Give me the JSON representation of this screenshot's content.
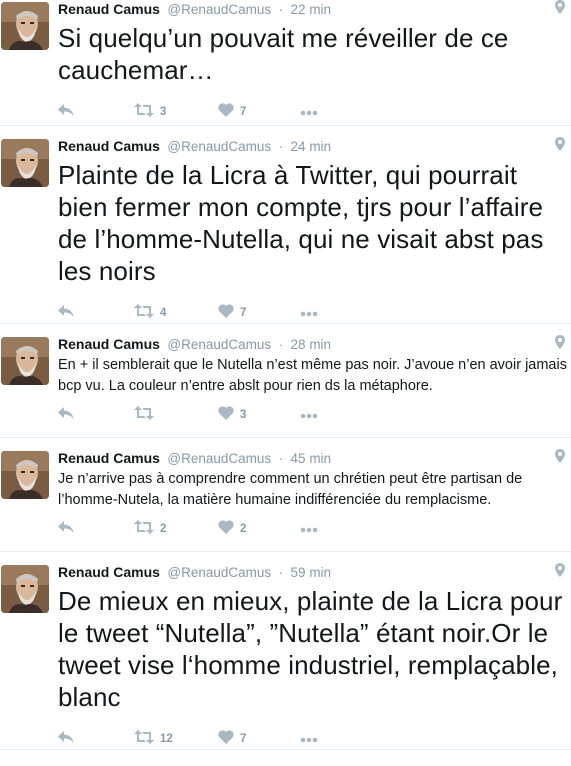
{
  "author": {
    "name": "Renaud Camus",
    "handle": "@RenaudCamus"
  },
  "separator": "·",
  "tweets": [
    {
      "time": "22 min",
      "text": "Si quelqu’un pouvait me réveiller de ce cauchemar…",
      "retweets": "3",
      "likes": "7"
    },
    {
      "time": "24 min",
      "text": "Plainte de la Licra à Twitter, qui pourrait bien fermer mon compte, tjrs pour l’affaire de l’homme-Nutella, qui ne visait abst pas les noirs",
      "retweets": "4",
      "likes": "7"
    },
    {
      "time": "28 min",
      "text": "En + il semblerait que le Nutella n’est même pas noir. J’avoue n’en avoir jamais bcp vu. La couleur n’entre abslt pour rien ds la métaphore.",
      "retweets": "",
      "likes": "3"
    },
    {
      "time": "45 min",
      "text": "Je n’arrive pas à comprendre comment un chrétien peut être partisan de  l’homme-Nutela, la matière humaine indifférenciée du remplacisme.",
      "retweets": "2",
      "likes": "2"
    },
    {
      "time": "59 min",
      "text": "De mieux en mieux, plainte de la Licra pour le tweet “Nutella”, ”Nutella” étant noir.Or le tweet vise l‘homme industriel, remplaçable, blanc",
      "retweets": "12",
      "likes": "7"
    }
  ],
  "icons": {
    "reply": "reply-icon",
    "retweet": "retweet-icon",
    "like": "heart-icon",
    "more": "more-dots-icon",
    "location": "location-pin-icon"
  },
  "colors": {
    "name": "#14171a",
    "meta": "#8899a6",
    "icon": "#aab8c2",
    "divider": "#e6ecf0"
  }
}
